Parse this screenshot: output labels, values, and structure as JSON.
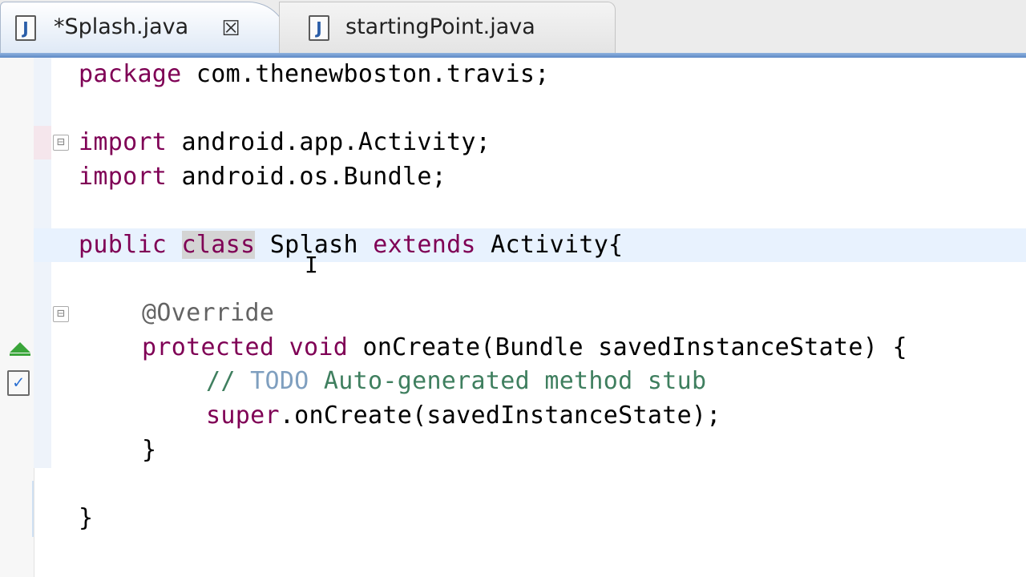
{
  "tabs": [
    {
      "label": "*Splash.java",
      "icon": "java-file-icon",
      "active": true,
      "close_glyph": "☒"
    },
    {
      "label": "startingPoint.java",
      "icon": "java-file-icon",
      "active": false
    }
  ],
  "file_icon_glyph": "J",
  "colors": {
    "keyword": "#7f0055",
    "comment": "#3f7f5f",
    "todo": "#7f9fbf",
    "annotation": "#646464",
    "tab_underline": "#5d88c5",
    "current_line": "#e8f2fe"
  },
  "code": {
    "line_package": {
      "kw": "package",
      "rest": " com.thenewboston.travis;"
    },
    "line_import1": {
      "kw": "import",
      "rest": " android.app.Activity;"
    },
    "line_import2": {
      "kw": "import",
      "rest": " android.os.Bundle;"
    },
    "line_class": {
      "kw1": "public",
      "kw2": "class",
      "name": " Splash ",
      "kw3": "extends",
      "rest": " Activity{"
    },
    "line_annotation": "@Override",
    "line_method": {
      "kw1": "protected",
      "kw2": "void",
      "rest": " onCreate(Bundle savedInstanceState) {"
    },
    "line_comment": {
      "prefix": "// ",
      "todo": "TODO",
      "rest": " Auto-generated method stub"
    },
    "line_super": {
      "kw": "super",
      "rest": ".onCreate(savedInstanceState);"
    },
    "close_method": "}",
    "close_class": "}"
  },
  "gutter": {
    "fold_glyph": "⊟",
    "markers": [
      "fold-icon",
      "override-icon",
      "task-icon"
    ]
  },
  "cursor_glyph": "I"
}
